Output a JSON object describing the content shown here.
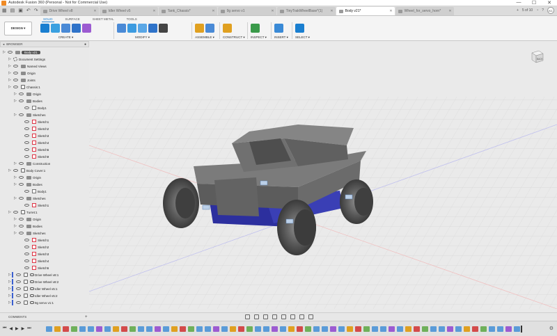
{
  "window": {
    "title": "Autodesk Fusion 360 (Personal - Not for Commercial Use)",
    "controls": [
      "—",
      "☐",
      "✕"
    ]
  },
  "tabs": [
    {
      "label": "Drive Wheel v8",
      "active": false
    },
    {
      "label": "Idler Wheel v5",
      "active": false
    },
    {
      "label": "Tank_Chassis*",
      "active": false
    },
    {
      "label": "9g servo v1",
      "active": false
    },
    {
      "label": "TinyTrakWheelBase*(1)",
      "active": false
    },
    {
      "label": "Body v21*",
      "active": true
    },
    {
      "label": "Wheel_for_servo_horn*",
      "active": false
    }
  ],
  "tabbar_right": {
    "page_count": "5 of 10",
    "avatar": "KC"
  },
  "toolbar": {
    "workspace": "DESIGN ▾",
    "workspace_tabs": [
      {
        "label": "SOLID",
        "active": true
      },
      {
        "label": "SURFACE",
        "active": false
      },
      {
        "label": "SHEET METAL",
        "active": false
      },
      {
        "label": "TOOLS",
        "active": false
      }
    ],
    "groups": [
      {
        "label": "CREATE ▾",
        "colors": [
          "#1a7fd0",
          "#3aa0e0",
          "#4a8ad6",
          "#2f73c9",
          "#9c5bd1"
        ]
      },
      {
        "label": "MODIFY ▾",
        "colors": [
          "#4a8ad6",
          "#3c9be0",
          "#5aa7e6",
          "#2f73c9",
          "#444444"
        ]
      },
      {
        "label": "ASSEMBLE ▾",
        "colors": [
          "#e0a020",
          "#4a8ad6"
        ]
      },
      {
        "label": "CONSTRUCT ▾",
        "colors": [
          "#e0a020"
        ]
      },
      {
        "label": "INSPECT ▾",
        "colors": [
          "#3a9a4a"
        ]
      },
      {
        "label": "INSERT ▾",
        "colors": [
          "#3a8ad6"
        ]
      },
      {
        "label": "SELECT ▾",
        "colors": [
          "#1a7fd0"
        ]
      }
    ]
  },
  "browser": {
    "title": "BROWSER",
    "items": [
      {
        "label": "Body v21",
        "depth": 0,
        "type": "root"
      },
      {
        "label": "Document Settings",
        "depth": 1,
        "type": "gear"
      },
      {
        "label": "Named Views",
        "depth": 1,
        "type": "folder"
      },
      {
        "label": "Origin",
        "depth": 1,
        "type": "folder"
      },
      {
        "label": "Joints",
        "depth": 1,
        "type": "folder"
      },
      {
        "label": "Chassis:1",
        "depth": 1,
        "type": "component"
      },
      {
        "label": "Origin",
        "depth": 2,
        "type": "folder"
      },
      {
        "label": "Bodies",
        "depth": 2,
        "type": "folder"
      },
      {
        "label": "Body1",
        "depth": 3,
        "type": "body"
      },
      {
        "label": "Sketches",
        "depth": 2,
        "type": "folder"
      },
      {
        "label": "Sketch1",
        "depth": 3,
        "type": "sketch"
      },
      {
        "label": "Sketch2",
        "depth": 3,
        "type": "sketch"
      },
      {
        "label": "Sketch3",
        "depth": 3,
        "type": "sketch"
      },
      {
        "label": "Sketch4",
        "depth": 3,
        "type": "sketch"
      },
      {
        "label": "Sketch5",
        "depth": 3,
        "type": "sketch"
      },
      {
        "label": "Sketch9",
        "depth": 3,
        "type": "sketch"
      },
      {
        "label": "Construction",
        "depth": 2,
        "type": "folder"
      },
      {
        "label": "Body Cover:1",
        "depth": 1,
        "type": "component"
      },
      {
        "label": "Origin",
        "depth": 2,
        "type": "folder"
      },
      {
        "label": "Bodies",
        "depth": 2,
        "type": "folder"
      },
      {
        "label": "Body1",
        "depth": 3,
        "type": "body"
      },
      {
        "label": "Sketches",
        "depth": 2,
        "type": "folder"
      },
      {
        "label": "Sketch1",
        "depth": 3,
        "type": "sketch"
      },
      {
        "label": "Turret:1",
        "depth": 1,
        "type": "component"
      },
      {
        "label": "Origin",
        "depth": 2,
        "type": "folder"
      },
      {
        "label": "Bodies",
        "depth": 2,
        "type": "folder"
      },
      {
        "label": "Sketches",
        "depth": 2,
        "type": "folder"
      },
      {
        "label": "Sketch1",
        "depth": 3,
        "type": "sketch"
      },
      {
        "label": "Sketch2",
        "depth": 3,
        "type": "sketch"
      },
      {
        "label": "Sketch3",
        "depth": 3,
        "type": "sketch"
      },
      {
        "label": "Sketch4",
        "depth": 3,
        "type": "sketch"
      },
      {
        "label": "Sketch5",
        "depth": 3,
        "type": "sketch"
      },
      {
        "label": "Drive Wheel v8:1",
        "depth": 1,
        "type": "linked"
      },
      {
        "label": "Drive Wheel v8:2",
        "depth": 1,
        "type": "linked"
      },
      {
        "label": "Idler Wheel v5:1",
        "depth": 1,
        "type": "linked"
      },
      {
        "label": "Idler Wheel v5:2",
        "depth": 1,
        "type": "linked"
      },
      {
        "label": "9g servo v1:1",
        "depth": 1,
        "type": "linked"
      }
    ]
  },
  "viewcube": {
    "face": "BACK"
  },
  "comments": {
    "label": "COMMENTS",
    "add": "+"
  },
  "timeline": {
    "controls": [
      "⏮",
      "◀",
      "▶",
      "▶",
      "⏭"
    ],
    "settings": "⚙"
  },
  "colors": {
    "accent": "#1a7fd0",
    "chassis_gray": "#6f6f6f",
    "blue_part": "#2c2f9e",
    "sketch_red": "#dd3344"
  }
}
